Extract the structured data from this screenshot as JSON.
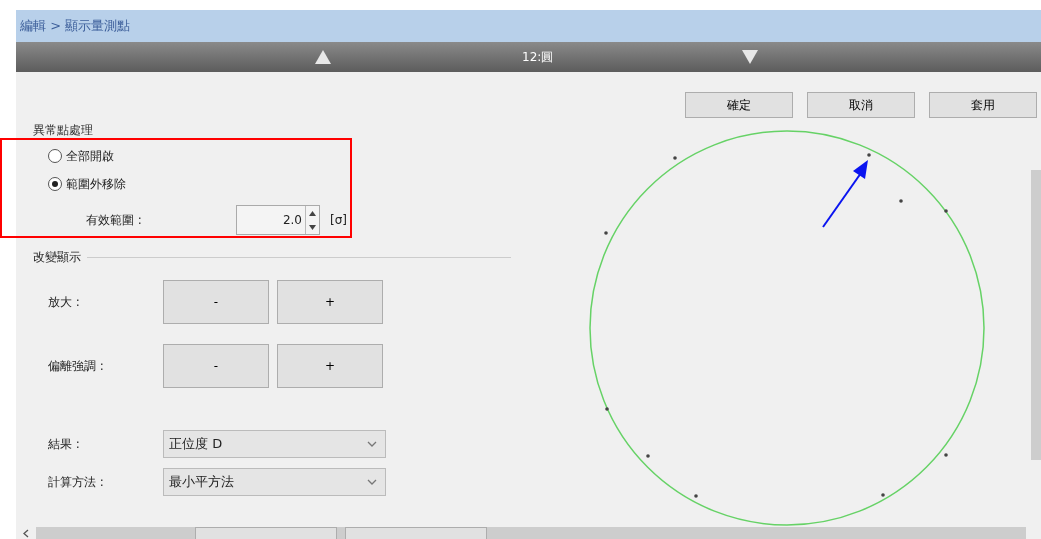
{
  "breadcrumb": "編輯 > 顯示量測點",
  "nav": {
    "title": "12:圓"
  },
  "actions": [
    "確定",
    "取消",
    "套用"
  ],
  "outlier": {
    "heading": "異常點處理",
    "options": [
      {
        "label": "全部開啟",
        "selected": false
      },
      {
        "label": "範圍外移除",
        "selected": true
      }
    ],
    "range": {
      "label": "有效範圍 :",
      "value": "2.0",
      "unit": "[σ]"
    }
  },
  "display": {
    "heading": "改變顯示",
    "rows": [
      {
        "label": "放大 :",
        "buttons": [
          "-",
          "+"
        ]
      },
      {
        "label": "偏離強調 :",
        "buttons": [
          "-",
          "+"
        ]
      }
    ]
  },
  "selects": [
    {
      "label": "結果 :",
      "value": "正位度 D"
    },
    {
      "label": "計算方法 :",
      "value": "最小平方法"
    }
  ]
}
